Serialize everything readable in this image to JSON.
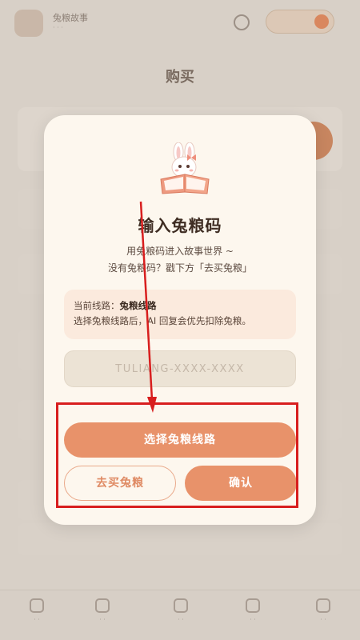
{
  "background": {
    "app_name": "兔粮故事",
    "app_subtitle": "· · ·",
    "top_pill_label": "· · ·",
    "page_title": "购买",
    "nav_items": [
      {
        "label": "· ·"
      },
      {
        "label": "· ·"
      },
      {
        "label": "· ·"
      },
      {
        "label": "· ·"
      },
      {
        "label": "· ·"
      }
    ]
  },
  "modal": {
    "title": "输入兔粮码",
    "desc_line1": "用兔粮码进入故事世界 ~",
    "desc_line2": "没有兔粮码？戳下方「去买兔粮」",
    "info": {
      "route_prefix": "当前线路：",
      "route_name": "兔粮线路",
      "note": "选择兔粮线路后，AI 回复会优先扣除兔粮。"
    },
    "code_input": {
      "placeholder": "TULIANG-XXXX-XXXX",
      "value": ""
    },
    "select_route_button": "选择兔粮线路",
    "buy_button": "去买兔粮",
    "confirm_button": "确认"
  },
  "icons": {
    "mascot": "bunny-reading-book-icon",
    "arrow": "red-arrow-annotation"
  },
  "colors": {
    "accent": "#e8926a",
    "modal_bg": "#fdf7ee",
    "info_bg": "#fbeadd",
    "annotation": "#d81e1e"
  }
}
